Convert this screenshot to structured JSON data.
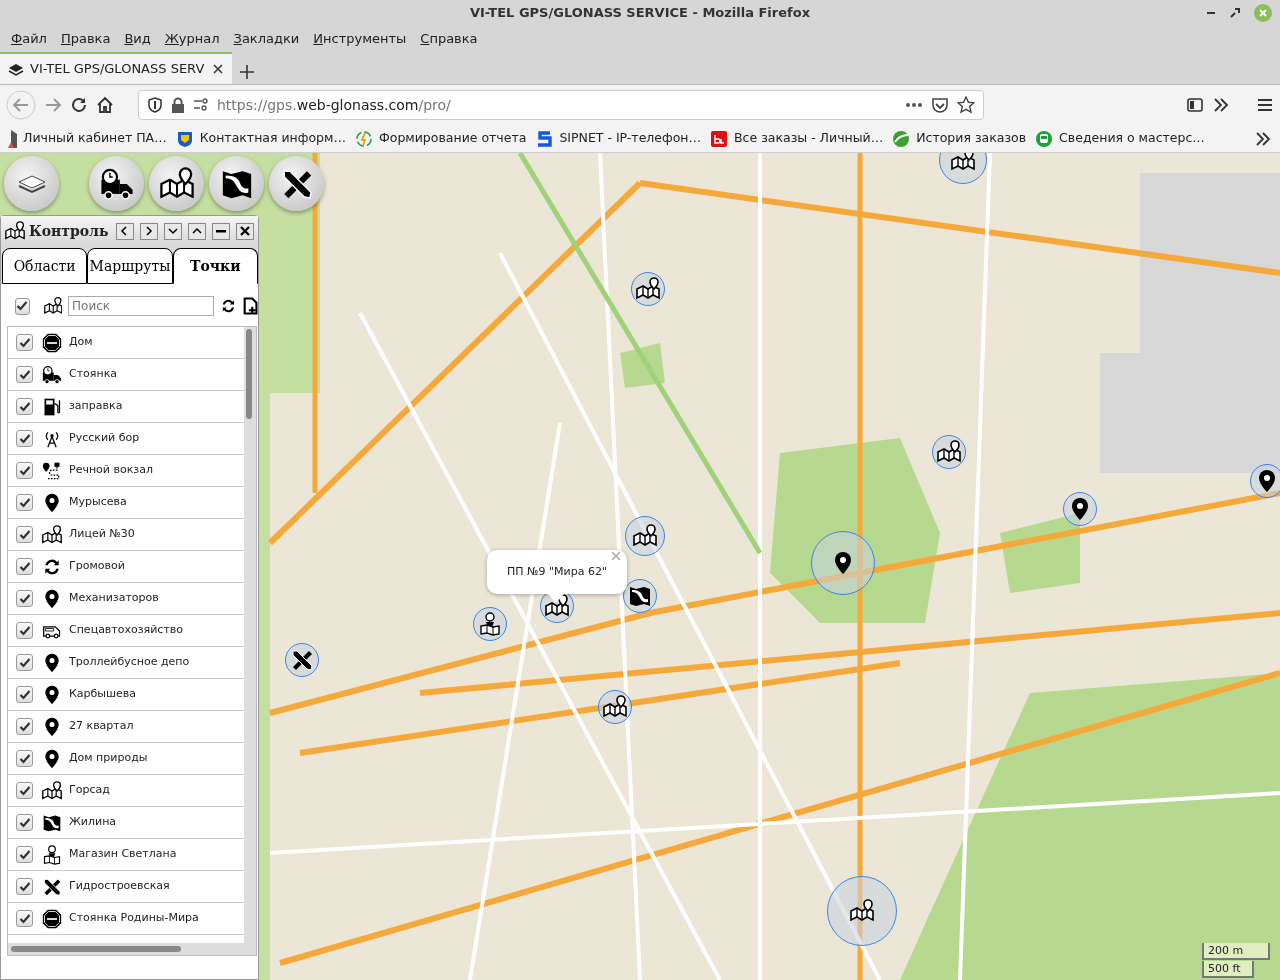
{
  "window": {
    "title": "VI-TEL GPS/GLONASS SERVICE - Mozilla Firefox"
  },
  "menu": [
    "Файл",
    "Правка",
    "Вид",
    "Журнал",
    "Закладки",
    "Инструменты",
    "Справка"
  ],
  "tabs": [
    {
      "label": "VI-TEL GPS/GLONASS SERV",
      "selected": true
    }
  ],
  "url": {
    "prefix": "https://gps.",
    "domain": "web-glonass.com",
    "suffix": "/pro/"
  },
  "bookmarks": [
    "Личный кабинет ПА…",
    "Контактная информ…",
    "Формирование отчета",
    "SIPNET - IP-телефон…",
    "Все заказы - Личный…",
    "История заказов",
    "Сведения о мастерс…"
  ],
  "panel": {
    "title": "Контроль",
    "tabs": [
      {
        "label": "Области",
        "selected": false
      },
      {
        "label": "Маршруты",
        "selected": false
      },
      {
        "label": "Точки",
        "selected": true
      }
    ],
    "select_all": {
      "checked": true
    },
    "search": {
      "placeholder": "Поиск"
    },
    "items": [
      {
        "label": "Дом",
        "kind": "stop",
        "checked": true
      },
      {
        "label": "Стоянка",
        "kind": "truck",
        "checked": true
      },
      {
        "label": "заправка",
        "kind": "fuel",
        "checked": true
      },
      {
        "label": "Русский бор",
        "kind": "antenna",
        "checked": true
      },
      {
        "label": "Речной вокзал",
        "kind": "route",
        "checked": true
      },
      {
        "label": "Мурысева",
        "kind": "pin",
        "checked": true
      },
      {
        "label": "Лицей №30",
        "kind": "mappin",
        "checked": true
      },
      {
        "label": "Громовой",
        "kind": "refresh",
        "checked": true
      },
      {
        "label": "Механизаторов",
        "kind": "pin",
        "checked": true
      },
      {
        "label": "Спецавтохозяйство",
        "kind": "van",
        "checked": true
      },
      {
        "label": "Троллейбусное депо",
        "kind": "pin",
        "checked": true
      },
      {
        "label": "Карбышева",
        "kind": "pin",
        "checked": true
      },
      {
        "label": "27 квартал",
        "kind": "pin",
        "checked": true
      },
      {
        "label": "Дом природы",
        "kind": "pin",
        "checked": true
      },
      {
        "label": "Горсад",
        "kind": "mappin",
        "checked": true
      },
      {
        "label": "Жилина",
        "kind": "map",
        "checked": true
      },
      {
        "label": "Магазин Светлана",
        "kind": "person",
        "checked": true
      },
      {
        "label": "Гидростроевская",
        "kind": "tools",
        "checked": true
      },
      {
        "label": "Стоянка Родины-Мира",
        "kind": "stop",
        "checked": true
      }
    ]
  },
  "popup": {
    "text": "ПП №9 \"Мира 62\""
  },
  "scale": [
    "200 m",
    "500 ft"
  ]
}
